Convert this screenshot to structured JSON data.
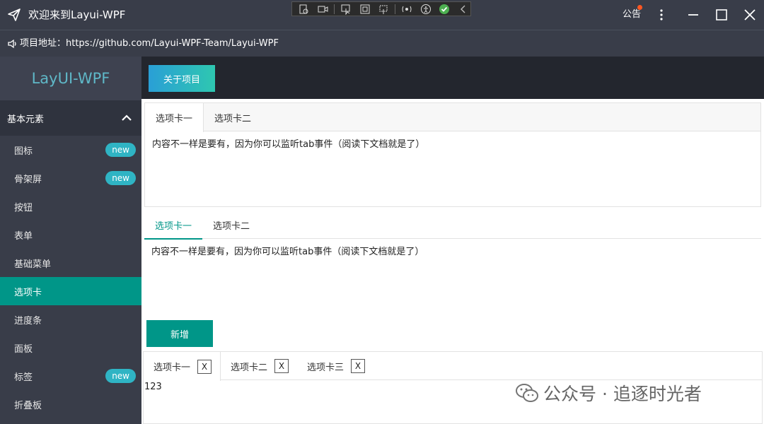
{
  "window": {
    "title": "欢迎来到Layui-WPF",
    "notice_label": "公告"
  },
  "urlbar": {
    "text": "项目地址：https://github.com/Layui-WPF-Team/Layui-WPF"
  },
  "sidebar": {
    "logo": "LayUI-WPF",
    "group_title": "基本元素",
    "items": [
      {
        "label": "图标",
        "badge": "new"
      },
      {
        "label": "骨架屏",
        "badge": "new"
      },
      {
        "label": "按钮",
        "badge": ""
      },
      {
        "label": "表单",
        "badge": ""
      },
      {
        "label": "基础菜单",
        "badge": ""
      },
      {
        "label": "选项卡",
        "badge": ""
      },
      {
        "label": "进度条",
        "badge": ""
      },
      {
        "label": "面板",
        "badge": ""
      },
      {
        "label": "标签",
        "badge": "new"
      },
      {
        "label": "折叠板",
        "badge": ""
      }
    ],
    "active_index": 5
  },
  "topbar": {
    "about_label": "关于项目"
  },
  "card_tab": {
    "tabs": [
      "选项卡一",
      "选项卡二"
    ],
    "content": "内容不一样是要有，因为你可以监听tab事件（阅读下文档就是了）"
  },
  "brief_tab": {
    "tabs": [
      "选项卡一",
      "选项卡二"
    ],
    "content": "内容不一样是要有，因为你可以监听tab事件（阅读下文档就是了）"
  },
  "add_button": {
    "label": "新增"
  },
  "close_tab": {
    "tabs": [
      {
        "label": "选项卡一",
        "close": "X"
      },
      {
        "label": "选项卡二",
        "close": "X"
      },
      {
        "label": "选项卡三",
        "close": "X"
      }
    ],
    "content": "123"
  },
  "watermark": {
    "text": "公众号 · 追逐时光者"
  },
  "colors": {
    "accent": "#009688",
    "dark": "#393d49",
    "badge": "#2fb4c4"
  }
}
